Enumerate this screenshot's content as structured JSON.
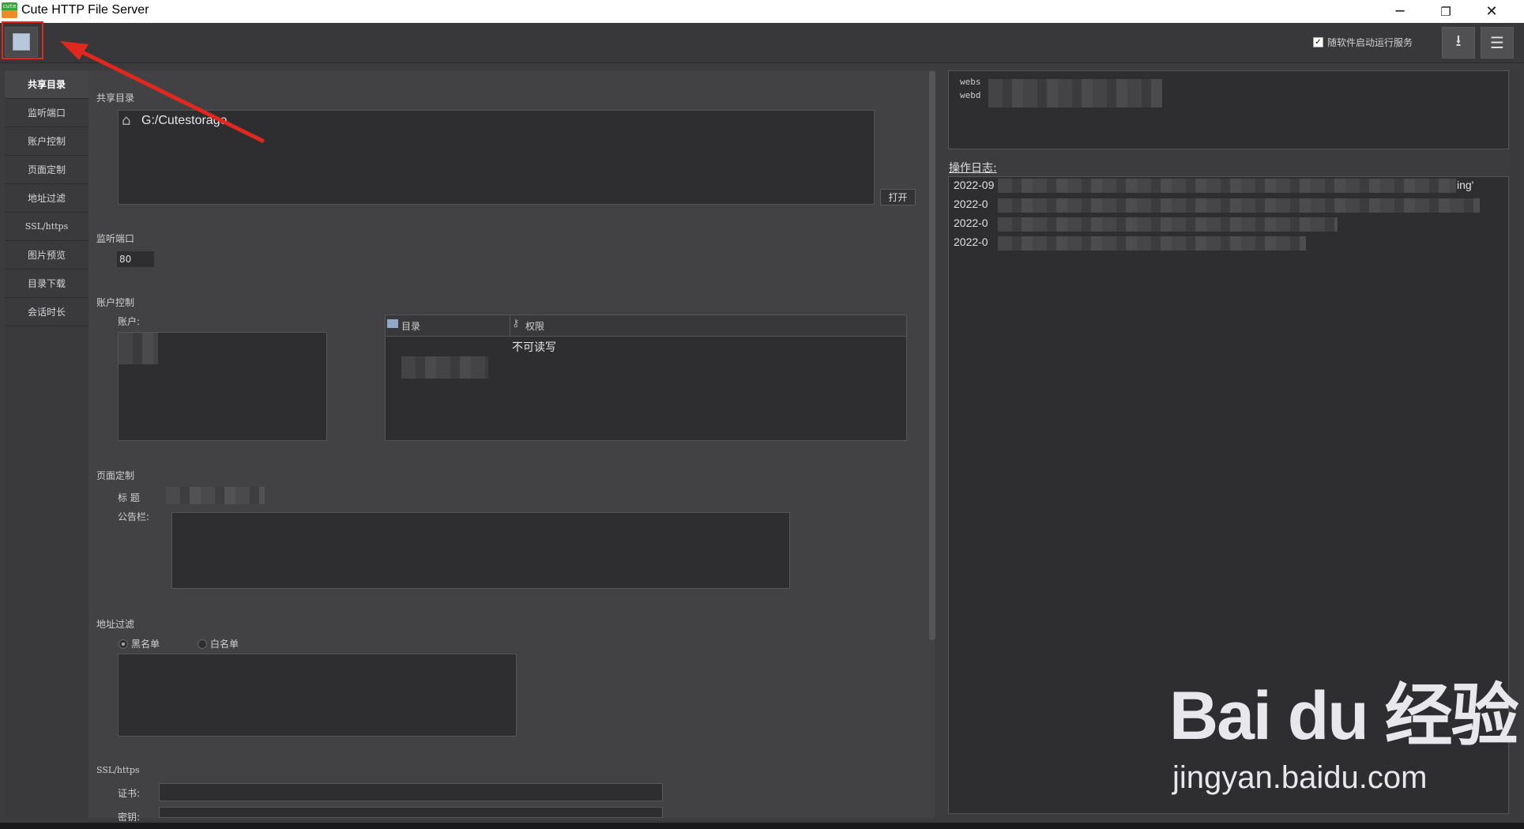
{
  "window": {
    "title": "Cute HTTP File Server",
    "icon_label": "cute",
    "minimize_glyph": "─",
    "restore_glyph": "❐",
    "close_glyph": "✕"
  },
  "toolbar": {
    "autostart_label": "随软件启动运行服务",
    "autostart_checked": true,
    "download_icon": "⭳",
    "menu_icon": "☰"
  },
  "sidenav": {
    "items": [
      {
        "label": "共享目录",
        "active": true
      },
      {
        "label": "监听端口"
      },
      {
        "label": "账户控制"
      },
      {
        "label": "页面定制"
      },
      {
        "label": "地址过滤"
      },
      {
        "label": "SSL/https"
      },
      {
        "label": "图片预览"
      },
      {
        "label": "目录下载"
      },
      {
        "label": "会话时长"
      }
    ]
  },
  "shared_dir": {
    "section_label": "共享目录",
    "path": "G:/Cutestorage",
    "open_button": "打开"
  },
  "port": {
    "section_label": "监听端口",
    "value": "80"
  },
  "accounts": {
    "section_label": "账户控制",
    "account_label": "账户:",
    "columns": [
      "目录",
      "权限"
    ],
    "rows": [
      {
        "dir": "",
        "perm": "不可读写"
      }
    ]
  },
  "page_custom": {
    "section_label": "页面定制",
    "title_label": "标  题",
    "notice_label": "公告栏:"
  },
  "addr_filter": {
    "section_label": "地址过滤",
    "blacklist_label": "黑名单",
    "whitelist_label": "白名单",
    "selected": "blacklist"
  },
  "ssl": {
    "section_label": "SSL/https",
    "cert_label": "证书:",
    "key_label": "密钥:"
  },
  "info": {
    "line1": "webs",
    "line2": "webd"
  },
  "log": {
    "label": "操作日志:",
    "lines": [
      "2022-09",
      "2022-0",
      "2022-0",
      "2022-0"
    ],
    "line1_tail": "ing'"
  },
  "watermark": {
    "logo": "Bai du 经验",
    "url": "jingyan.baidu.com"
  }
}
